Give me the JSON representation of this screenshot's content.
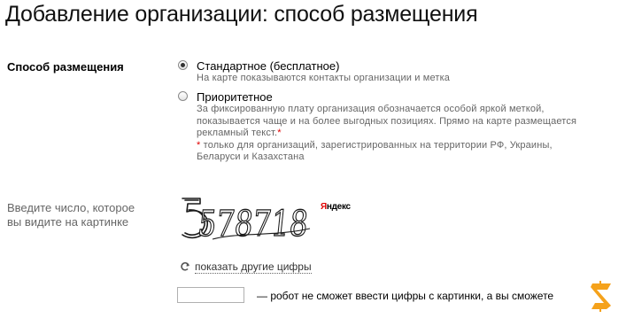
{
  "page": {
    "title": "Добавление организации: способ размещения"
  },
  "placement": {
    "label": "Способ размещения",
    "options": [
      {
        "label": "Стандартное (бесплатное)",
        "selected": true,
        "desc": [
          "На карте показываются контакты организации и метка"
        ]
      },
      {
        "label": "Приоритетное",
        "selected": false,
        "desc": [
          "За фиксированную плату организация обозначается особой яркой меткой,",
          "показывается чаще и на более выгодных позициях. Прямо на карте размещается",
          "рекламный текст."
        ],
        "desc_star": "*",
        "footnote_star": "*",
        "footnote": [
          " только для организаций, зарегистрированных на территории РФ, Украины,",
          "Беларуси и Казахстана"
        ]
      }
    ]
  },
  "captcha": {
    "label_line1": "Введите число, которое",
    "label_line2": "вы видите на картинке",
    "digits": "578718",
    "brand_first": "Я",
    "brand_rest": "ндекс",
    "refresh_label": "показать другие цифры",
    "input_value": "",
    "hint": "— робот не сможет ввести цифры с картинки, а вы сможете",
    "badge_letter": "Z"
  },
  "colors": {
    "accent_red": "#e00000",
    "badge_orange": "#f5a21b",
    "secondary_text": "#666666"
  }
}
